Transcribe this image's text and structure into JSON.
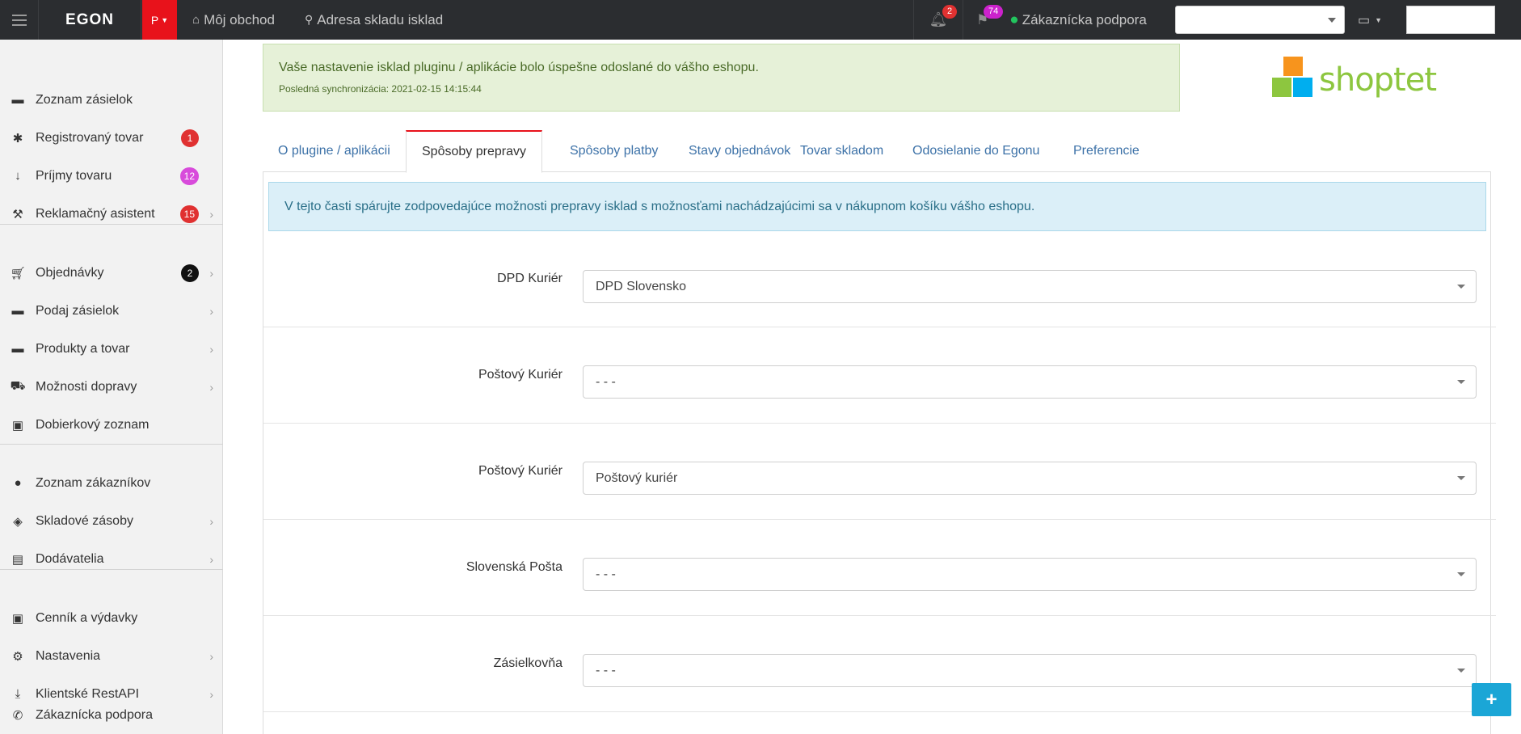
{
  "topbar": {
    "brand": "EGON",
    "brand_badge": "P",
    "nav_shop": "Môj obchod",
    "nav_address": "Adresa skladu isklad",
    "notifications_count": "2",
    "messages_count": "74",
    "support_label": "Zákaznícka podpora",
    "select_value": "",
    "search_value": ""
  },
  "sidebar": {
    "items": [
      {
        "label": "Zoznam zásielok",
        "icon": "archive-icon",
        "glyph": "▬"
      },
      {
        "label": "Registrovaný tovar",
        "icon": "asterisk-icon",
        "glyph": "✱",
        "badge": "1",
        "badge_color": "#e03131"
      },
      {
        "label": "Príjmy tovaru",
        "icon": "arrow-down-icon",
        "glyph": "↓",
        "badge": "12",
        "badge_color": "#d84bdb"
      },
      {
        "label": "Reklamačný asistent",
        "icon": "hammer-icon",
        "glyph": "⚒",
        "badge": "15",
        "badge_color": "#e03131",
        "chevron": true
      },
      {
        "label": "Objednávky",
        "icon": "cart-icon",
        "glyph": "⛟",
        "badge": "2",
        "badge_color": "#111111",
        "chevron": true
      },
      {
        "label": "Podaj zásielok",
        "icon": "archive-icon",
        "glyph": "▬",
        "chevron": true
      },
      {
        "label": "Produkty a tovar",
        "icon": "archive-icon",
        "glyph": "▬",
        "chevron": true
      },
      {
        "label": "Možnosti dopravy",
        "icon": "truck-icon",
        "glyph": "⛟",
        "chevron": true
      },
      {
        "label": "Dobierkový zoznam",
        "icon": "money-icon",
        "glyph": "▣"
      },
      {
        "label": "Zoznam zákazníkov",
        "icon": "user-icon",
        "glyph": "●"
      },
      {
        "label": "Skladové zásoby",
        "icon": "shield-icon",
        "glyph": "◈",
        "chevron": true
      },
      {
        "label": "Dodávatelia",
        "icon": "briefcase-icon",
        "glyph": "▤",
        "chevron": true
      },
      {
        "label": "Cenník a výdavky",
        "icon": "money-icon",
        "glyph": "▣"
      },
      {
        "label": "Nastavenia",
        "icon": "gear-icon",
        "glyph": "⚙",
        "chevron": true
      },
      {
        "label": "Klientské RestAPI",
        "icon": "download-icon",
        "glyph": "⤓",
        "chevron": true
      },
      {
        "label": "Zákaznícka podpora",
        "icon": "support-icon",
        "glyph": "✆"
      }
    ]
  },
  "alert_success": {
    "message": "Vaše nastavenie isklad pluginu / aplikácie bolo úspešne odoslané do vášho eshopu.",
    "sync": "Posledná synchronizácia: 2021-02-15 14:15:44"
  },
  "logo_text": "shoptet",
  "tabs": [
    {
      "label": "O plugine / aplikácii"
    },
    {
      "label": "Spôsoby prepravy",
      "active": true
    },
    {
      "label": "Spôsoby platby"
    },
    {
      "label": "Stavy objednávok"
    },
    {
      "label": "Tovar skladom"
    },
    {
      "label": "Odosielanie do Egonu"
    },
    {
      "label": "Preferencie"
    }
  ],
  "info_text": "V tejto časti spárujte zodpovedajúce možnosti prepravy isklad s možnosťami nachádzajúcimi sa v nákupnom košíku vášho eshopu.",
  "form_rows": [
    {
      "label": "DPD Kuriér",
      "value": "DPD Slovensko"
    },
    {
      "label": "Poštový Kuriér",
      "value": "- - -"
    },
    {
      "label": "Poštový Kuriér",
      "value": "Poštový kuriér"
    },
    {
      "label": "Slovenská Pošta",
      "value": "- - -"
    },
    {
      "label": "Zásielkovňa",
      "value": "- - -"
    }
  ],
  "fab_label": "+",
  "colors": {
    "topbar_bg": "#2b2d30",
    "brand_red": "#e8121b",
    "link_blue": "#3d72a8",
    "success_bg": "#e6f1d8",
    "info_bg": "#dbeff8",
    "fab_blue": "#1ba6d6",
    "logo_green": "#8dc63f",
    "logo_orange": "#f7941d",
    "logo_cyan": "#00aeef"
  }
}
